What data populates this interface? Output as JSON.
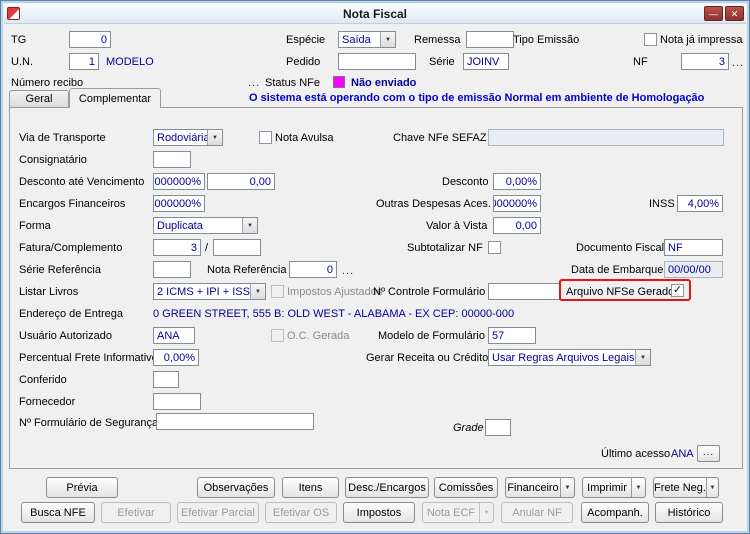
{
  "window": {
    "title": "Nota Fiscal"
  },
  "icons": {
    "minimize": "—",
    "close": "✕",
    "dropdown": "▼",
    "check": "✓",
    "more": "...",
    "fatura_sep": "/"
  },
  "colors": {
    "status_swatch": "#ff00ff",
    "highlight": "#ee1111",
    "banner_text": "#0000cc",
    "value_text": "#00009b"
  },
  "header": {
    "tg_label": "TG",
    "tg_value": "0",
    "especie_label": "Espécie",
    "especie_value": "Saída",
    "remessa_label": "Remessa",
    "remessa_value": "",
    "tipo_emissao_label": "Tipo Emissão",
    "nota_impressa_label": "Nota já impressa",
    "un_label": "U.N.",
    "un_value": "1",
    "un_desc": "MODELO",
    "pedido_label": "Pedido",
    "pedido_value": "",
    "serie_label": "Série",
    "serie_value": "JOINV",
    "nf_label": "NF",
    "nf_value": "3",
    "recibo_label": "Número recibo",
    "status_label": "Status NFe",
    "status_value": "Não enviado"
  },
  "tabs": {
    "geral": "Geral",
    "complementar": "Complementar"
  },
  "banner": "O sistema está operando com o tipo de emissão Normal em ambiente de Homologação",
  "form": {
    "via_label": "Via de Transporte",
    "via_value": "Rodoviária",
    "nota_avulsa_label": "Nota Avulsa",
    "chave_label": "Chave NFe SEFAZ",
    "chave_value": "",
    "consignatario_label": "Consignatário",
    "consignatario_value": "",
    "desc_venc_label": "Desconto até Vencimento",
    "desc_venc_pct": "000000%",
    "desc_venc_valor": "0,00",
    "desconto_label": "Desconto",
    "desconto_value": "0,00%",
    "encargos_label": "Encargos Financeiros",
    "encargos_value": "000000%",
    "outras_label": "Outras Despesas Aces.",
    "outras_value": "000000%",
    "inss_label": "INSS",
    "inss_value": "4,00%",
    "forma_label": "Forma",
    "forma_value": "Duplicata",
    "valor_vista_label": "Valor à Vista",
    "valor_vista_value": "0,00",
    "fatura_label": "Fatura/Complemento",
    "fatura_value": "3",
    "fatura_value2": "",
    "subtotalizar_label": "Subtotalizar NF",
    "doc_fiscal_label": "Documento Fiscal",
    "doc_fiscal_value": "NF",
    "serie_ref_label": "Série Referência",
    "serie_ref_value": "",
    "nota_ref_label": "Nota Referência",
    "nota_ref_value": "0",
    "data_embarque_label": "Data de Embarque",
    "data_embarque_value": "00/00/00",
    "listar_label": "Listar Livros",
    "listar_value": "2 ICMS + IPI + ISS",
    "impostos_ajustados_label": "Impostos Ajustados",
    "controle_label": "Nº Controle Formulário",
    "controle_value": "",
    "arquivo_nfse_label": "Arquivo NFSe Gerado",
    "endereco_label": "Endereço de Entrega",
    "endereco_value": "0 GREEN STREET, 555 B: OLD WEST - ALABAMA - EX CEP: 00000-000",
    "usuario_label": "Usuário Autorizado",
    "usuario_value": "ANA",
    "oc_label": "O.C. Gerada",
    "modelo_label": "Modelo de Formulário",
    "modelo_value": "57",
    "perc_frete_label": "Percentual Frete Informativo",
    "perc_frete_value": "0,00%",
    "gerar_label": "Gerar Receita ou Crédito",
    "gerar_value": "Usar Regras Arquivos Legais",
    "conferido_label": "Conferido",
    "conferido_value": "",
    "fornecedor_label": "Fornecedor",
    "fornecedor_value": "",
    "form_seg_label": "Nº Formulário de Segurança",
    "form_seg_value": "",
    "grade_label": "Grade",
    "grade_value": "",
    "ultimo_acesso_label": "Último acesso",
    "ultimo_acesso_value": "ANA"
  },
  "buttons": {
    "row1": [
      "Prévia",
      "Observações",
      "Itens",
      "Desc./Encargos",
      "Comissões",
      "Financeiro",
      "Imprimir",
      "Frete Neg."
    ],
    "row2": [
      "Busca NFE",
      "Efetivar",
      "Efetivar Parcial",
      "Efetivar OS",
      "Impostos",
      "Nota ECF",
      "Anular NF",
      "Acompanh.",
      "Histórico"
    ]
  }
}
